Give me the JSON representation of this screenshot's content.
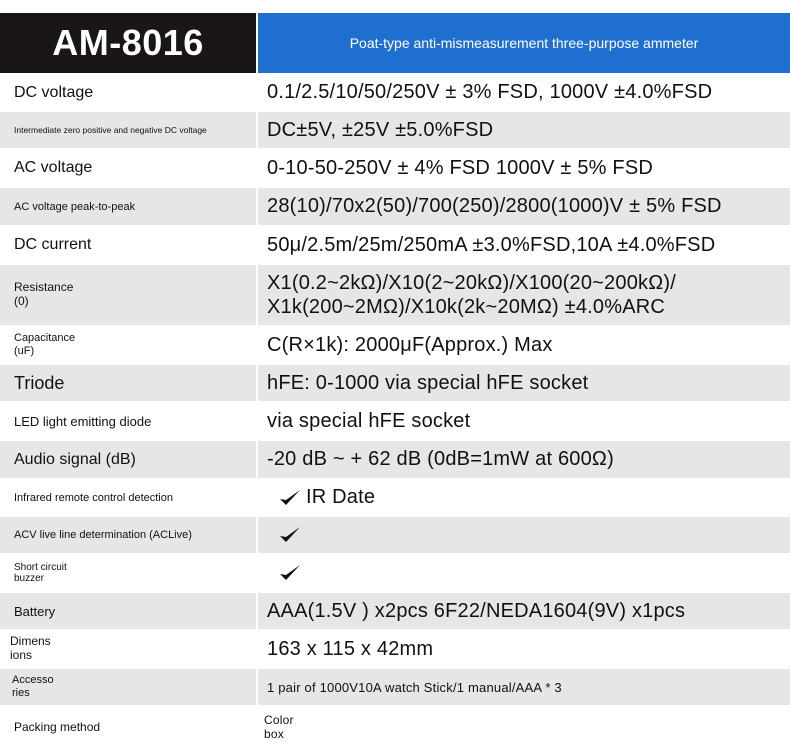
{
  "header": {
    "model": "AM-8016",
    "subtitle": "Poat-type anti-mismeasurement three-purpose ammeter"
  },
  "rows": [
    {
      "label": "DC voltage",
      "value": "0.1/2.5/10/50/250V ± 3% FSD, 1000V ±4.0%FSD"
    },
    {
      "label": "Intermediate zero positive and negative DC voltage",
      "value": "DC±5V, ±25V ±5.0%FSD"
    },
    {
      "label": "AC voltage",
      "value": "0-10-50-250V ± 4% FSD 1000V ± 5% FSD"
    },
    {
      "label": "AC voltage peak-to-peak",
      "value": "28(10)/70x2(50)/700(250)/2800(1000)V  ± 5% FSD"
    },
    {
      "label": "DC current",
      "value": "50μ/2.5m/25m/250mA ±3.0%FSD,10A ±4.0%FSD"
    },
    {
      "label": "Resistance\n(0)",
      "value": "X1(0.2~2kΩ)/X10(2~20kΩ)/X100(20~200kΩ)/\nX1k(200~2MΩ)/X10k(2k~20MΩ) ±4.0%ARC"
    },
    {
      "label": "Capacitance\n(uF)",
      "value": "C(R×1k): 2000μF(Approx.) Max"
    },
    {
      "label": "Triode",
      "value": "hFE: 0-1000 via special hFE socket"
    },
    {
      "label": "LED light emitting diode",
      "value": "via special hFE socket"
    },
    {
      "label": "Audio signal (dB)",
      "value": "-20 dB ~ + 62 dB (0dB=1mW at 600Ω)"
    },
    {
      "label": "Infrared remote control detection",
      "value": "IR Date"
    },
    {
      "label": "ACV live line determination (ACLive)",
      "value": ""
    },
    {
      "label": "Short circuit\nbuzzer",
      "value": ""
    },
    {
      "label": "Battery",
      "value": "AAA(1.5V ) x2pcs  6F22/NEDA1604(9V) x1pcs"
    },
    {
      "label": "Dimens\nions",
      "value": "163 x 115 x 42mm"
    },
    {
      "label": "Accesso\nries",
      "value": "1 pair of 1000V10A watch Stick/1 manual/AAA * 3"
    },
    {
      "label": "Packing method",
      "value": "Color\nbox"
    }
  ],
  "icons": {
    "check": "checkmark-icon",
    "check_color": "#111111"
  },
  "colors": {
    "header_dark": "#1b1616",
    "header_blue": "#1f6fd0",
    "row_grey": "#e6e6e6"
  }
}
